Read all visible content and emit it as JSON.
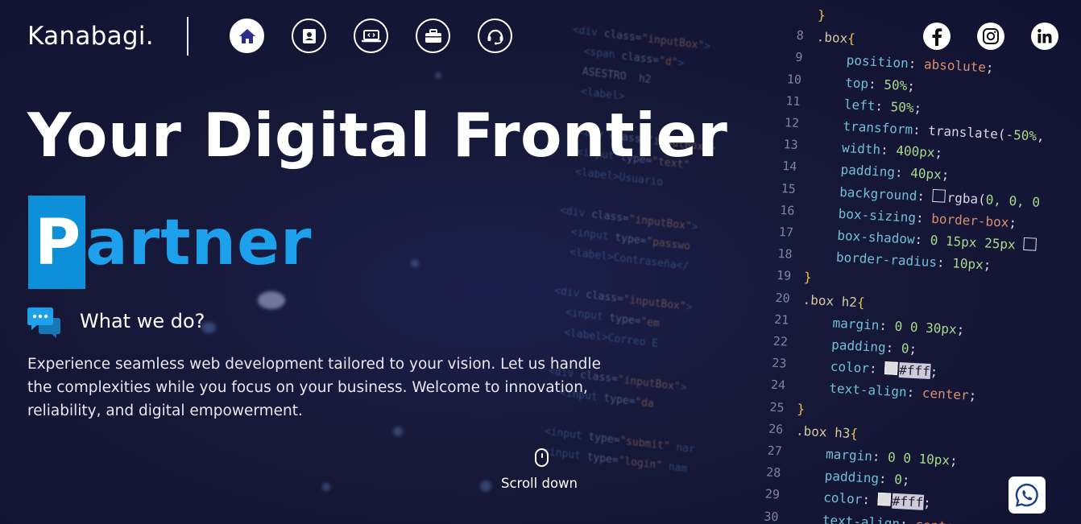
{
  "header": {
    "logo": "Kanabagi.",
    "nav": [
      {
        "name": "home",
        "icon": "home-icon",
        "active": true
      },
      {
        "name": "about",
        "icon": "contact-book-icon",
        "active": false
      },
      {
        "name": "services",
        "icon": "laptop-code-icon",
        "active": false
      },
      {
        "name": "portfolio",
        "icon": "briefcase-icon",
        "active": false
      },
      {
        "name": "contact",
        "icon": "headset-icon",
        "active": false
      }
    ],
    "social": [
      {
        "name": "facebook",
        "icon": "facebook-icon"
      },
      {
        "name": "instagram",
        "icon": "instagram-icon"
      },
      {
        "name": "linkedin",
        "icon": "linkedin-icon"
      }
    ]
  },
  "hero": {
    "headline": "Your Digital Frontier",
    "highlight_first": "P",
    "highlight_rest": "artner",
    "section_title": "What we do?",
    "description": "Experience seamless web development tailored to your vision. Let us handle the complexities while you focus on your business. Welcome to innovation, reliability, and digital empowerment.",
    "scroll_label": "Scroll down"
  },
  "floating": {
    "whatsapp_icon": "whatsapp-icon"
  },
  "colors": {
    "background": "#141433",
    "accent": "#0d8fd9",
    "accent_text": "#1da1ec",
    "nav_icon": "#2d2d8c"
  },
  "background_code": {
    "line_numbers": [
      "",
      "8",
      "9",
      "10",
      "11",
      "12",
      "13",
      "14",
      "15",
      "16",
      "17",
      "18",
      "19",
      "20",
      "21",
      "22",
      "23",
      "24",
      "25",
      "26",
      "27",
      "28",
      "29",
      "30"
    ]
  }
}
